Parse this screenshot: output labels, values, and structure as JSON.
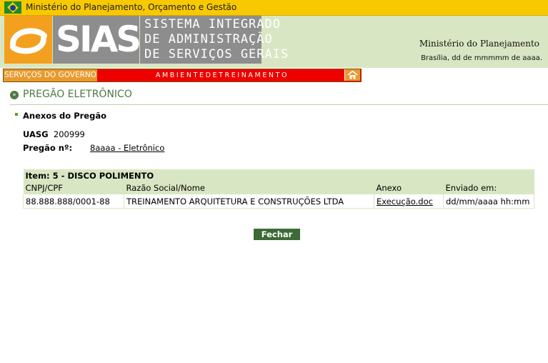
{
  "topbar": {
    "text": "Ministério do Planejamento, Orçamento e Gestão"
  },
  "header": {
    "logo_text": "SIASG",
    "system_lines": [
      "SISTEMA INTEGRADO",
      "DE ADMINISTRAÇÃO",
      "DE SERVIÇOS GERAIS"
    ],
    "ministry": "Ministério do Planejamento",
    "date": "Brasília, dd de mmmmm de aaaa."
  },
  "nav": {
    "servicos": "SERVIÇOS DO GOVERNO",
    "ambiente": "AMBIENTEDETREINAMENTO",
    "home_icon": "home-icon"
  },
  "page": {
    "title": "PREGÃO ELETRÔNICO",
    "section_title": "Anexos do Pregão",
    "uasg_label": "UASG",
    "uasg_value": "200999",
    "pregao_label": "Pregão nº:",
    "pregao_value": "8aaaa - Eletrônico"
  },
  "table": {
    "item_title": "Item: 5 - DISCO POLIMENTO",
    "headers": [
      "CNPJ/CPF",
      "Razão Social/Nome",
      "Anexo",
      "Enviado em:"
    ],
    "rows": [
      [
        "88.888.888/0001-88",
        "TREINAMENTO ARQUITETURA E CONSTRUÇÕES LTDA",
        "Execução.doc",
        "dd/mm/aaaa hh:mm"
      ]
    ]
  },
  "buttons": {
    "close": "Fechar"
  },
  "colors": {
    "top_bar": "#f9c900",
    "header_bg": "#d9e6c3",
    "nav_red": "#ee0000",
    "nav_orange": "#e89a2e",
    "accent_green": "#4b7a42",
    "button_green": "#3c6b36"
  }
}
